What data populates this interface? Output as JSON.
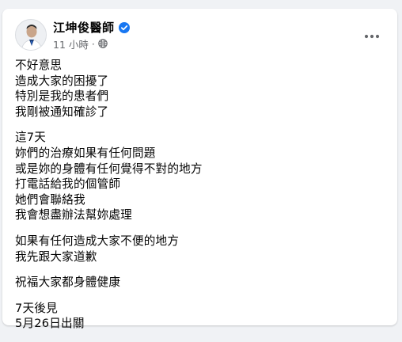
{
  "post": {
    "author_name": "江坤俊醫師",
    "timestamp": "11 小時",
    "separator": "·",
    "paragraphs": [
      [
        "不好意思",
        "造成大家的困擾了",
        "特別是我的患者們",
        "我剛被通知確診了"
      ],
      [
        "這7天",
        "妳們的治療如果有任何問題",
        "或是妳的身體有任何覺得不對的地方",
        "打電話給我的個管師",
        "她們會聯絡我",
        "我會想盡辦法幫妳處理"
      ],
      [
        "如果有任何造成大家不便的地方",
        "我先跟大家道歉"
      ],
      [
        "祝福大家都身體健康"
      ],
      [
        "7天後見",
        "5月26日出關"
      ]
    ]
  },
  "colors": {
    "background": "#f0f2f5",
    "card": "#ffffff",
    "verified_badge": "#1877f2",
    "meta_text": "#65676b"
  },
  "icons": {
    "verified": "verified-badge-icon",
    "audience": "globe-icon",
    "more": "more-options-icon"
  }
}
